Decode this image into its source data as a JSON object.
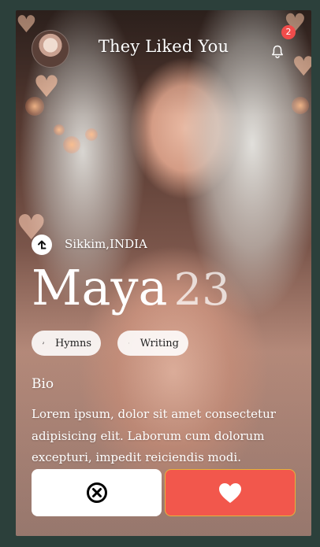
{
  "header": {
    "title": "They Liked You",
    "notification_count": "2",
    "avatar_icon": "user-avatar",
    "bell_icon": "bell-icon"
  },
  "profile": {
    "location": "Sikkim,INDIA",
    "location_icon": "arrow-up-icon",
    "name": "Maya",
    "age": "23",
    "interests": [
      {
        "label": "Hymns",
        "icon": "music-note-icon"
      },
      {
        "label": "Writing",
        "icon": "feather-icon"
      }
    ],
    "bio_heading": "Bio",
    "bio_text": "Lorem ipsum, dolor sit amet consectetur adipisicing elit. Laborum cum dolorum excepturi, impedit reiciendis modi."
  },
  "actions": {
    "pass_icon": "close-circle-icon",
    "like_icon": "heart-icon"
  },
  "colors": {
    "page_background": "#2c403b",
    "like_button": "#f2574c",
    "like_button_border": "#e7b33a",
    "pass_button": "#ffffff",
    "badge": "#f04c4b"
  }
}
